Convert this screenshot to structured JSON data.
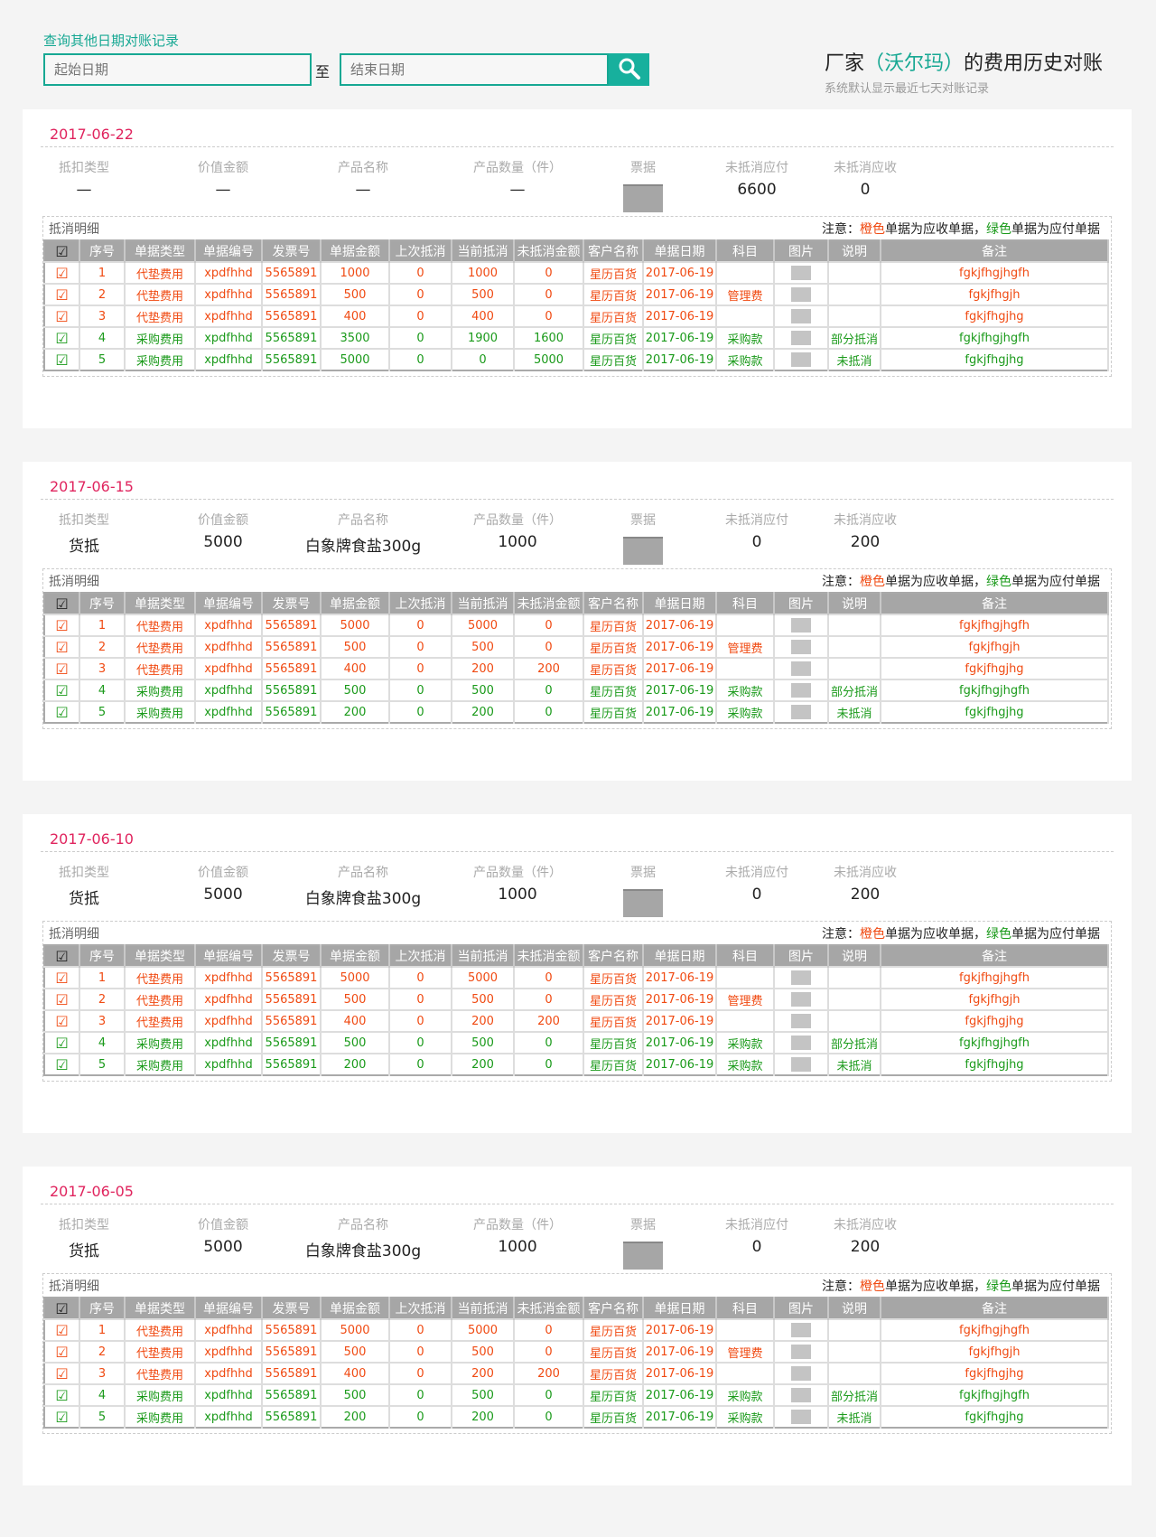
{
  "search": {
    "label": "查询其他日期对账记录",
    "start_placeholder": "起始日期",
    "to": "至",
    "end_placeholder": "结束日期"
  },
  "header": {
    "title_prefix": "厂家",
    "vendor": "（沃尔玛）",
    "title_suffix": "的费用历史对账",
    "subtitle": "系统默认显示最近七天对账记录"
  },
  "summary_labels": [
    "抵扣类型",
    "价值金额",
    "产品名称",
    "产品数量（件）",
    "票据",
    "未抵消应付",
    "未抵消应收"
  ],
  "detail": {
    "title": "抵消明细",
    "note_prefix": "注意：",
    "note_orange": "橙色",
    "note_mid": "单据为应收单据，",
    "note_green": "绿色",
    "note_suffix": "单据为应付单据"
  },
  "columns": [
    "☑",
    "序号",
    "单据类型",
    "单据编号",
    "发票号",
    "单据金额",
    "上次抵消",
    "当前抵消",
    "未抵消金额",
    "客户名称",
    "单据日期",
    "科目",
    "图片",
    "说明",
    "备注"
  ],
  "colors": {
    "accent": "#17a893",
    "orange": "#f04a12",
    "green": "#1a9a1a",
    "date": "#e0245e"
  },
  "cards": [
    {
      "date": "2017-06-22",
      "summary": [
        "—",
        "—",
        "—",
        "—",
        "6600",
        "0"
      ],
      "rows": [
        {
          "t": "o",
          "c": [
            "1",
            "代垫费用",
            "xpdfhhd",
            "5565891",
            "1000",
            "0",
            "1000",
            "0",
            "星历百货",
            "2017-06-19",
            "",
            "",
            "fgkjfhgjhgfh"
          ]
        },
        {
          "t": "o",
          "c": [
            "2",
            "代垫费用",
            "xpdfhhd",
            "5565891",
            "500",
            "0",
            "500",
            "0",
            "星历百货",
            "2017-06-19",
            "管理费",
            "",
            "fgkjfhgjh"
          ]
        },
        {
          "t": "o",
          "c": [
            "3",
            "代垫费用",
            "xpdfhhd",
            "5565891",
            "400",
            "0",
            "400",
            "0",
            "星历百货",
            "2017-06-19",
            "",
            "",
            "fgkjfhgjhg"
          ]
        },
        {
          "t": "g",
          "c": [
            "4",
            "采购费用",
            "xpdfhhd",
            "5565891",
            "3500",
            "0",
            "1900",
            "1600",
            "星历百货",
            "2017-06-19",
            "采购款",
            "部分抵消",
            "fgkjfhgjhgfh"
          ]
        },
        {
          "t": "g",
          "c": [
            "5",
            "采购费用",
            "xpdfhhd",
            "5565891",
            "5000",
            "0",
            "0",
            "5000",
            "星历百货",
            "2017-06-19",
            "采购款",
            "未抵消",
            "fgkjfhgjhg"
          ]
        }
      ]
    },
    {
      "date": "2017-06-15",
      "summary": [
        "货抵",
        "5000",
        "白象牌食盐300g",
        "1000",
        "0",
        "200"
      ],
      "rows": [
        {
          "t": "o",
          "c": [
            "1",
            "代垫费用",
            "xpdfhhd",
            "5565891",
            "5000",
            "0",
            "5000",
            "0",
            "星历百货",
            "2017-06-19",
            "",
            "",
            "fgkjfhgjhgfh"
          ]
        },
        {
          "t": "o",
          "c": [
            "2",
            "代垫费用",
            "xpdfhhd",
            "5565891",
            "500",
            "0",
            "500",
            "0",
            "星历百货",
            "2017-06-19",
            "管理费",
            "",
            "fgkjfhgjh"
          ]
        },
        {
          "t": "o",
          "c": [
            "3",
            "代垫费用",
            "xpdfhhd",
            "5565891",
            "400",
            "0",
            "200",
            "200",
            "星历百货",
            "2017-06-19",
            "",
            "",
            "fgkjfhgjhg"
          ]
        },
        {
          "t": "g",
          "c": [
            "4",
            "采购费用",
            "xpdfhhd",
            "5565891",
            "500",
            "0",
            "500",
            "0",
            "星历百货",
            "2017-06-19",
            "采购款",
            "部分抵消",
            "fgkjfhgjhgfh"
          ]
        },
        {
          "t": "g",
          "c": [
            "5",
            "采购费用",
            "xpdfhhd",
            "5565891",
            "200",
            "0",
            "200",
            "0",
            "星历百货",
            "2017-06-19",
            "采购款",
            "未抵消",
            "fgkjfhgjhg"
          ]
        }
      ]
    },
    {
      "date": "2017-06-10",
      "summary": [
        "货抵",
        "5000",
        "白象牌食盐300g",
        "1000",
        "0",
        "200"
      ],
      "rows": [
        {
          "t": "o",
          "c": [
            "1",
            "代垫费用",
            "xpdfhhd",
            "5565891",
            "5000",
            "0",
            "5000",
            "0",
            "星历百货",
            "2017-06-19",
            "",
            "",
            "fgkjfhgjhgfh"
          ]
        },
        {
          "t": "o",
          "c": [
            "2",
            "代垫费用",
            "xpdfhhd",
            "5565891",
            "500",
            "0",
            "500",
            "0",
            "星历百货",
            "2017-06-19",
            "管理费",
            "",
            "fgkjfhgjh"
          ]
        },
        {
          "t": "o",
          "c": [
            "3",
            "代垫费用",
            "xpdfhhd",
            "5565891",
            "400",
            "0",
            "200",
            "200",
            "星历百货",
            "2017-06-19",
            "",
            "",
            "fgkjfhgjhg"
          ]
        },
        {
          "t": "g",
          "c": [
            "4",
            "采购费用",
            "xpdfhhd",
            "5565891",
            "500",
            "0",
            "500",
            "0",
            "星历百货",
            "2017-06-19",
            "采购款",
            "部分抵消",
            "fgkjfhgjhgfh"
          ]
        },
        {
          "t": "g",
          "c": [
            "5",
            "采购费用",
            "xpdfhhd",
            "5565891",
            "200",
            "0",
            "200",
            "0",
            "星历百货",
            "2017-06-19",
            "采购款",
            "未抵消",
            "fgkjfhgjhg"
          ]
        }
      ]
    },
    {
      "date": "2017-06-05",
      "summary": [
        "货抵",
        "5000",
        "白象牌食盐300g",
        "1000",
        "0",
        "200"
      ],
      "rows": [
        {
          "t": "o",
          "c": [
            "1",
            "代垫费用",
            "xpdfhhd",
            "5565891",
            "5000",
            "0",
            "5000",
            "0",
            "星历百货",
            "2017-06-19",
            "",
            "",
            "fgkjfhgjhgfh"
          ]
        },
        {
          "t": "o",
          "c": [
            "2",
            "代垫费用",
            "xpdfhhd",
            "5565891",
            "500",
            "0",
            "500",
            "0",
            "星历百货",
            "2017-06-19",
            "管理费",
            "",
            "fgkjfhgjh"
          ]
        },
        {
          "t": "o",
          "c": [
            "3",
            "代垫费用",
            "xpdfhhd",
            "5565891",
            "400",
            "0",
            "200",
            "200",
            "星历百货",
            "2017-06-19",
            "",
            "",
            "fgkjfhgjhg"
          ]
        },
        {
          "t": "g",
          "c": [
            "4",
            "采购费用",
            "xpdfhhd",
            "5565891",
            "500",
            "0",
            "500",
            "0",
            "星历百货",
            "2017-06-19",
            "采购款",
            "部分抵消",
            "fgkjfhgjhgfh"
          ]
        },
        {
          "t": "g",
          "c": [
            "5",
            "采购费用",
            "xpdfhhd",
            "5565891",
            "200",
            "0",
            "200",
            "0",
            "星历百货",
            "2017-06-19",
            "采购款",
            "未抵消",
            "fgkjfhgjhg"
          ]
        }
      ]
    }
  ]
}
